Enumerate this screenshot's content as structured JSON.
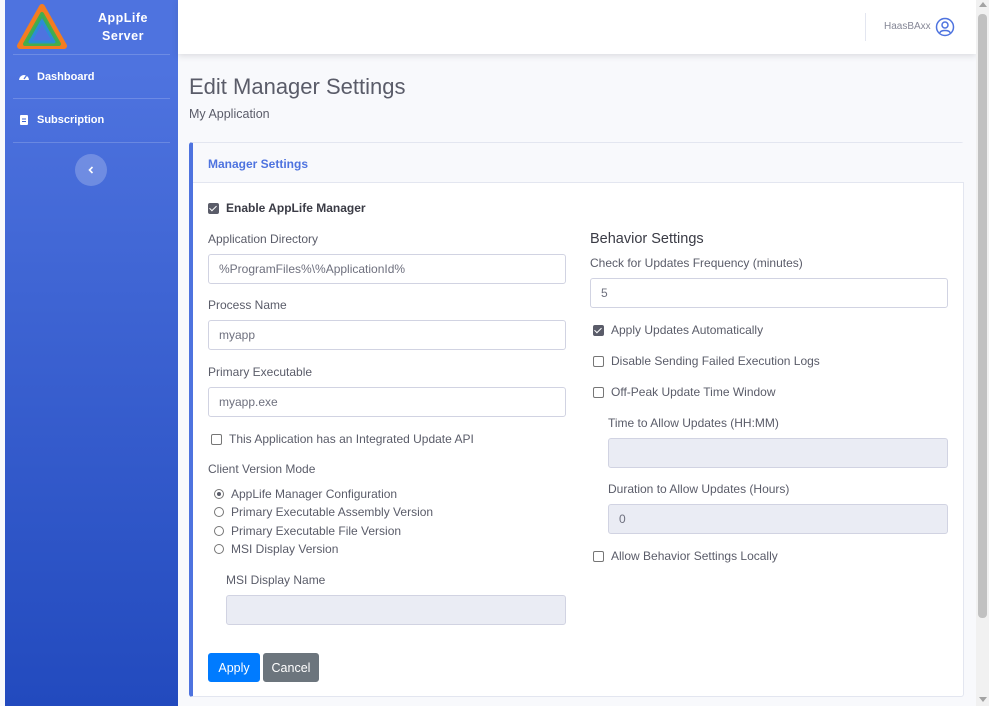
{
  "sidebar": {
    "brand_line1": "AppLife",
    "brand_line2": "Server",
    "items": [
      {
        "label": "Dashboard",
        "icon": "gauge-icon"
      },
      {
        "label": "Subscription",
        "icon": "document-icon"
      }
    ]
  },
  "topbar": {
    "username": "HaasBAxx"
  },
  "page": {
    "title": "Edit Manager Settings",
    "subtitle": "My Application"
  },
  "card": {
    "title": "Manager Settings",
    "enable_manager": {
      "label": "Enable AppLife Manager",
      "checked": true
    },
    "app_directory": {
      "label": "Application Directory",
      "value": "%ProgramFiles%\\%ApplicationId%"
    },
    "process_name": {
      "label": "Process Name",
      "value": "myapp"
    },
    "primary_executable": {
      "label": "Primary Executable",
      "value": "myapp.exe"
    },
    "integrated_api": {
      "label": "This Application has an Integrated Update API",
      "checked": false
    },
    "client_version_mode": {
      "label": "Client Version Mode",
      "options": [
        {
          "label": "AppLife Manager Configuration",
          "checked": true
        },
        {
          "label": "Primary Executable Assembly Version",
          "checked": false
        },
        {
          "label": "Primary Executable File Version",
          "checked": false
        },
        {
          "label": "MSI Display Version",
          "checked": false
        }
      ]
    },
    "msi_display_name": {
      "label": "MSI Display Name",
      "value": ""
    },
    "behavior": {
      "title": "Behavior Settings",
      "frequency": {
        "label": "Check for Updates Frequency (minutes)",
        "value": "5"
      },
      "apply_auto": {
        "label": "Apply Updates Automatically",
        "checked": true
      },
      "disable_logs": {
        "label": "Disable Sending Failed Execution Logs",
        "checked": false
      },
      "off_peak": {
        "label": "Off-Peak Update Time Window",
        "checked": false
      },
      "time_allow": {
        "label": "Time to Allow Updates (HH:MM)",
        "value": ""
      },
      "duration_allow": {
        "label": "Duration to Allow Updates (Hours)",
        "value": "0"
      },
      "allow_local": {
        "label": "Allow Behavior Settings Locally",
        "checked": false
      }
    },
    "buttons": {
      "apply": "Apply",
      "cancel": "Cancel"
    }
  },
  "colors": {
    "primary": "#4e73df",
    "button_primary": "#007bff",
    "button_secondary": "#6c757d"
  }
}
